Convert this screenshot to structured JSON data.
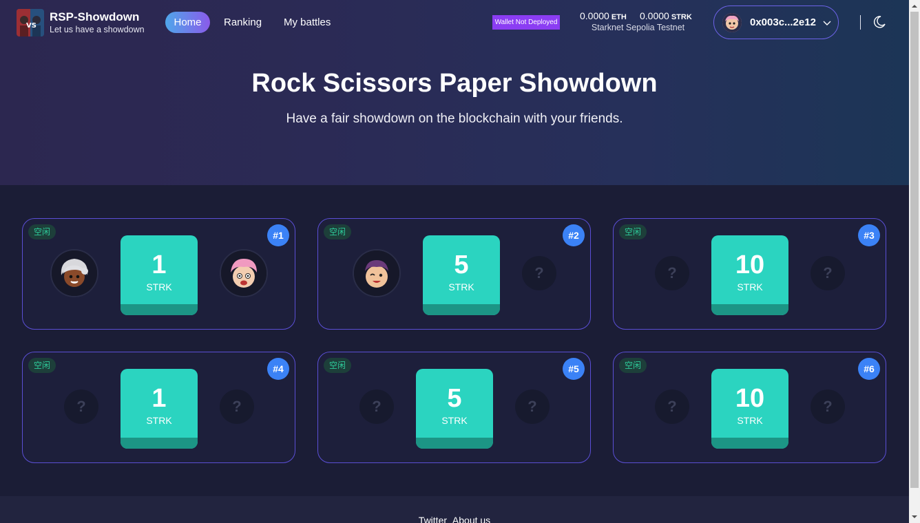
{
  "brand": {
    "title": "RSP-Showdown",
    "subtitle": "Let us have a showdown"
  },
  "nav": {
    "items": [
      "Home",
      "Ranking",
      "My battles"
    ],
    "active": "Home"
  },
  "wallet": {
    "status_badge": "Wallet Not Deployed",
    "eth_balance": "0.0000",
    "eth_unit": "ETH",
    "strk_balance": "0.0000",
    "strk_unit": "STRK",
    "network": "Starknet Sepolia Testnet",
    "address": "0x003c...2e12"
  },
  "hero": {
    "title": "Rock Scissors Paper Showdown",
    "subtitle": "Have a fair showdown on the blockchain with your friends."
  },
  "rooms": [
    {
      "status": "空闲",
      "number": "#1",
      "amount": "1",
      "currency": "STRK",
      "left": "player-silver-hair",
      "right": "player-pink-hair"
    },
    {
      "status": "空闲",
      "number": "#2",
      "amount": "5",
      "currency": "STRK",
      "left": "player-purple-hair",
      "right": "?"
    },
    {
      "status": "空闲",
      "number": "#3",
      "amount": "10",
      "currency": "STRK",
      "left": "?",
      "right": "?"
    },
    {
      "status": "空闲",
      "number": "#4",
      "amount": "1",
      "currency": "STRK",
      "left": "?",
      "right": "?"
    },
    {
      "status": "空闲",
      "number": "#5",
      "amount": "5",
      "currency": "STRK",
      "left": "?",
      "right": "?"
    },
    {
      "status": "空闲",
      "number": "#6",
      "amount": "10",
      "currency": "STRK",
      "left": "?",
      "right": "?"
    }
  ],
  "footer": {
    "links": [
      "Twitter",
      "About us"
    ]
  },
  "colors": {
    "accent_gradient_start": "#4fa6ea",
    "accent_gradient_end": "#8a5bea",
    "stake_teal": "#2bd4c0",
    "room_number_blue": "#3b82f6",
    "badge_purple": "#8b3df3",
    "status_green": "#2ecc9b"
  },
  "icons": [
    "logo-image",
    "chevron-down-icon",
    "moon-icon",
    "avatar"
  ]
}
